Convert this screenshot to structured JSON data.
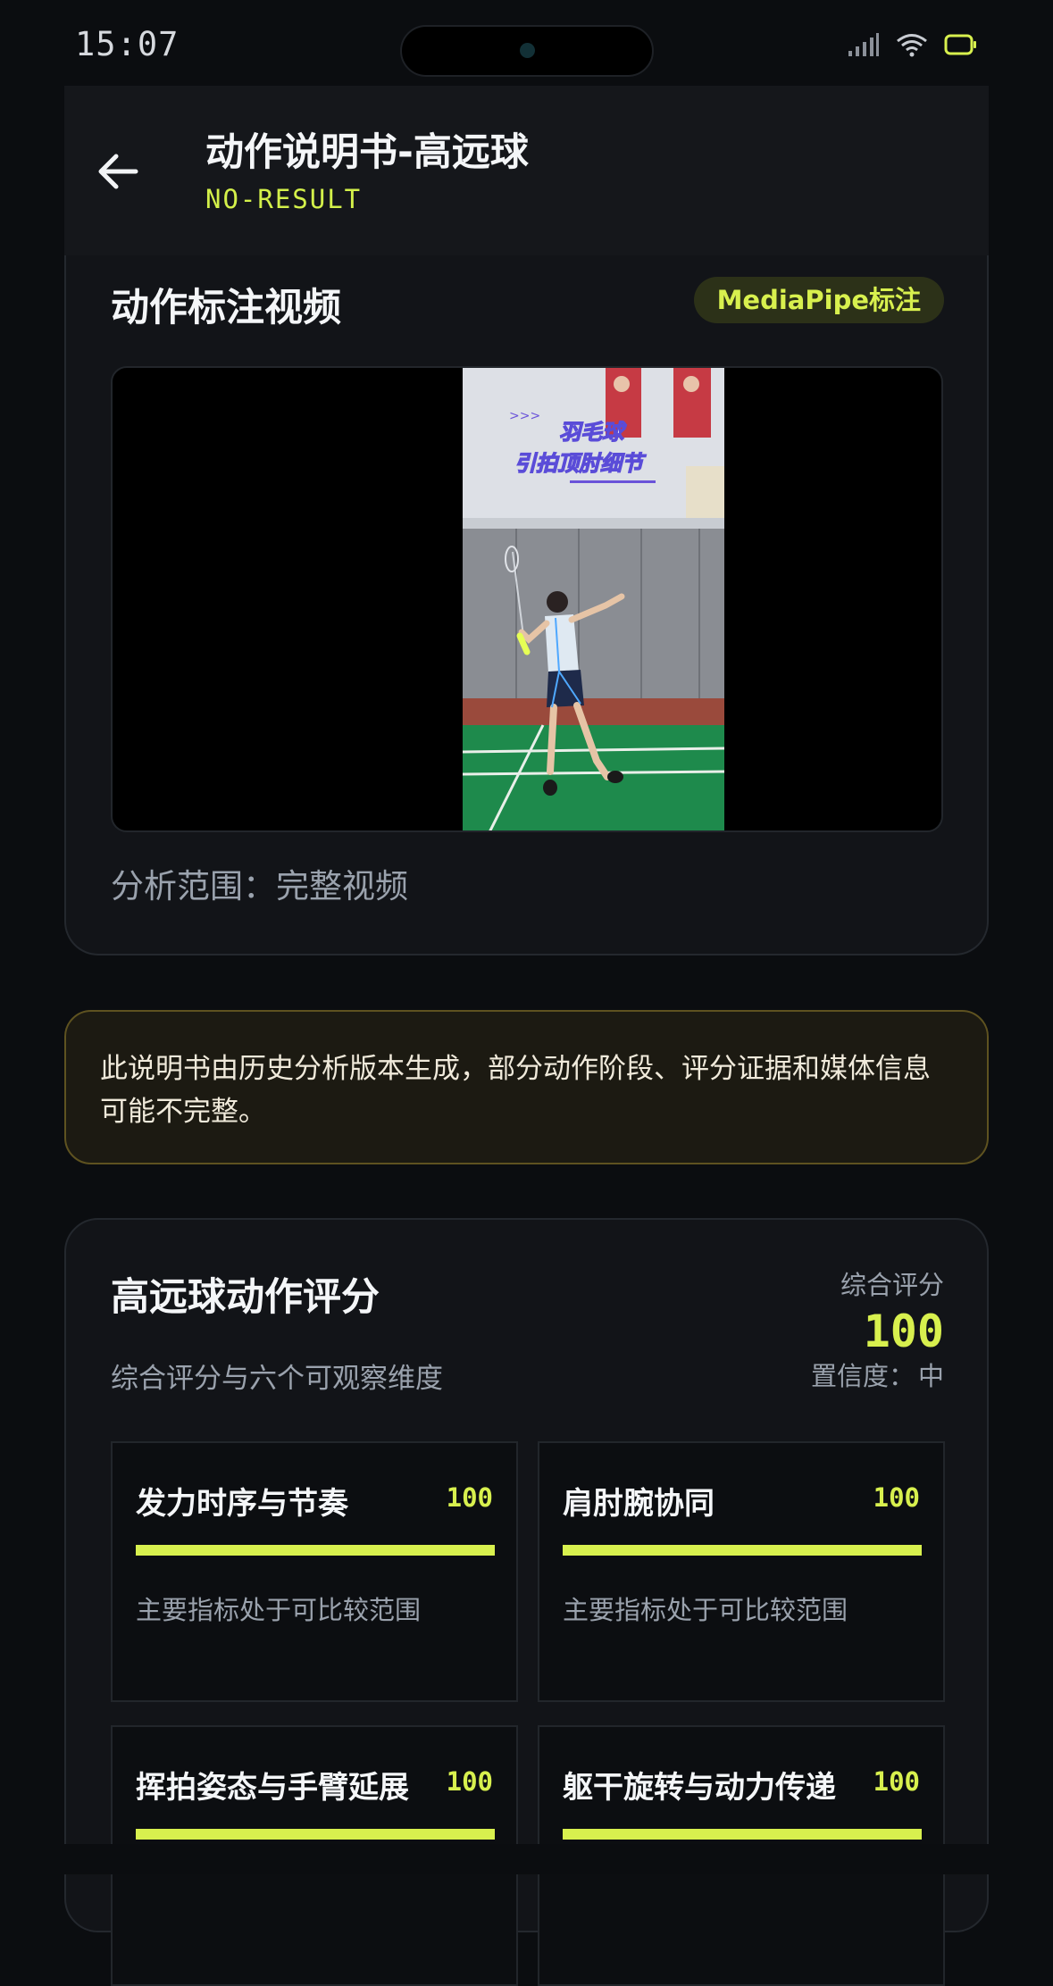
{
  "status_bar": {
    "time": "15:07"
  },
  "header": {
    "title": "动作说明书-高远球",
    "subtitle": "NO-RESULT"
  },
  "video_section": {
    "title": "动作标注视频",
    "badge": "MediaPipe标注",
    "video_overlay_line1": "羽毛球",
    "video_overlay_line2": "引拍顶肘细节",
    "range_label": "分析范围：",
    "range_value": "完整视频"
  },
  "notice": {
    "text": "此说明书由历史分析版本生成，部分动作阶段、评分证据和媒体信息可能不完整。"
  },
  "score_section": {
    "title": "高远球动作评分",
    "subtitle": "综合评分与六个可观察维度",
    "overall_label": "综合评分",
    "overall_value": "100",
    "confidence_label": "置信度：",
    "confidence_value": "中",
    "dimensions": [
      {
        "name": "发力时序与节奏",
        "score": "100",
        "note": "主要指标处于可比较范围",
        "level": 1.0
      },
      {
        "name": "肩肘腕协同",
        "score": "100",
        "note": "主要指标处于可比较范围",
        "level": 1.0
      },
      {
        "name": "挥拍姿态与手臂延展",
        "score": "100",
        "note": "",
        "level": 1.0
      },
      {
        "name": "躯干旋转与动力传递",
        "score": "100",
        "note": "",
        "level": 1.0
      }
    ]
  },
  "colors": {
    "accent": "#d8f04e",
    "background": "#0b0d10",
    "card": "#121418",
    "notice_border": "#5e5220"
  },
  "icons": {
    "back": "arrow-left-icon",
    "signal": "cellular-signal-icon",
    "wifi": "wifi-icon",
    "battery": "battery-icon"
  }
}
